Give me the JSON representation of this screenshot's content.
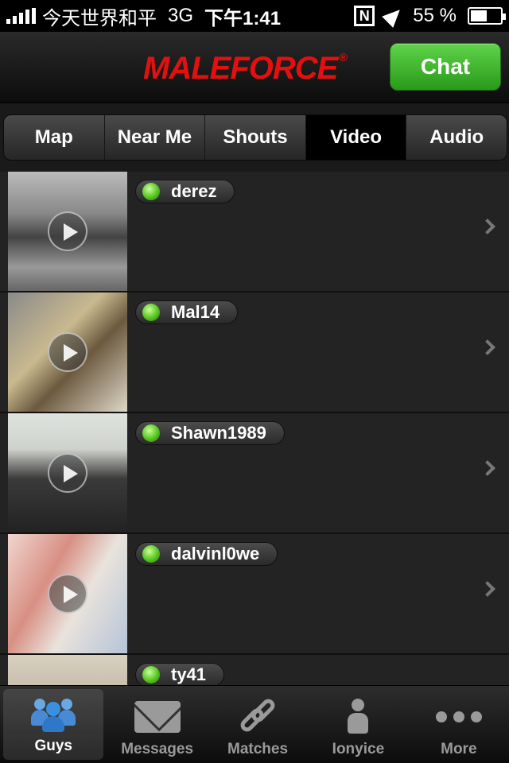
{
  "status_bar": {
    "carrier": "今天世界和平",
    "network": "3G",
    "time": "下午1:41",
    "network_badge": "N",
    "battery": "55 %"
  },
  "header": {
    "logo": "MALEFORCE",
    "logo_mark": "®",
    "chat_button": "Chat"
  },
  "tabs": [
    {
      "label": "Map",
      "active": false
    },
    {
      "label": "Near Me",
      "active": false
    },
    {
      "label": "Shouts",
      "active": false
    },
    {
      "label": "Video",
      "active": true
    },
    {
      "label": "Audio",
      "active": false
    }
  ],
  "users": [
    {
      "name": "derez",
      "online": true
    },
    {
      "name": "Mal14",
      "online": true
    },
    {
      "name": "Shawn1989",
      "online": true
    },
    {
      "name": "dalvinl0we",
      "online": true
    },
    {
      "name": "ty41",
      "online": true
    }
  ],
  "tabbar": [
    {
      "label": "Guys",
      "icon": "users-icon",
      "active": true
    },
    {
      "label": "Messages",
      "icon": "envelope-icon",
      "active": false
    },
    {
      "label": "Matches",
      "icon": "link-icon",
      "active": false
    },
    {
      "label": "Ionyice",
      "icon": "person-icon",
      "active": false
    },
    {
      "label": "More",
      "icon": "more-icon",
      "active": false
    }
  ],
  "colors": {
    "brand": "#e41010",
    "chat_green": "#3fbf2a",
    "online_green": "#55c51e",
    "active_tab_blue": "#3b8fe0"
  }
}
